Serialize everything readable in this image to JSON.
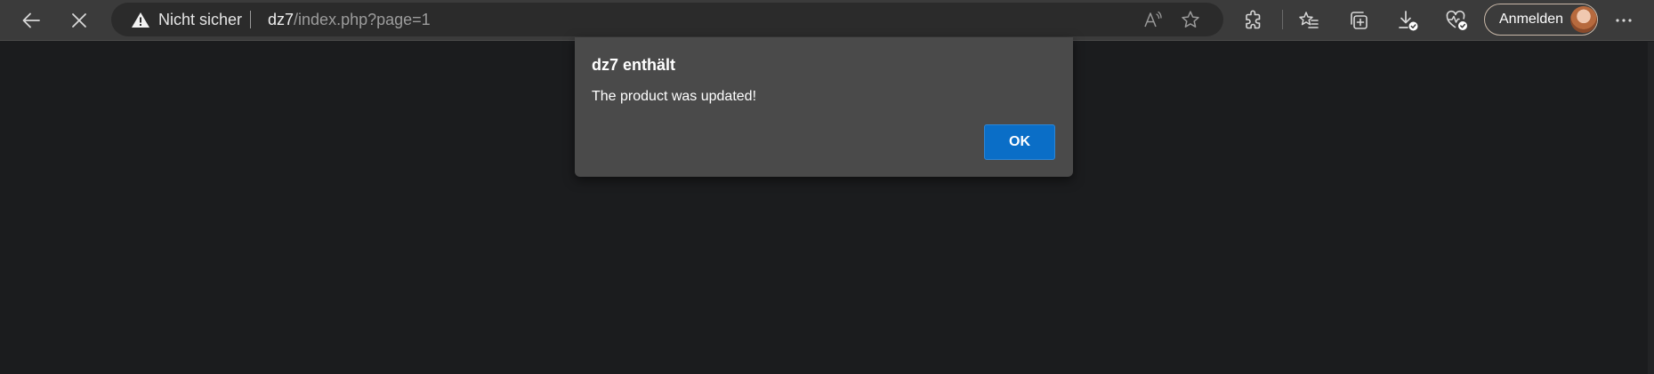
{
  "browser": {
    "address_bar": {
      "security_label": "Nicht sicher",
      "url_host": "dz7",
      "url_path": "/index.php?page=1"
    },
    "signin_label": "Anmelden",
    "icons": {
      "back": "arrow-left-icon",
      "stop": "close-icon",
      "warning": "warning-triangle-icon",
      "read_aloud": "read-aloud-icon",
      "favorite": "star-icon",
      "extensions": "puzzle-icon",
      "favorites": "favorites-list-icon",
      "collections": "collections-icon",
      "downloads": "download-icon",
      "health": "heart-pulse-icon",
      "menu": "more-horizontal-icon"
    }
  },
  "dialog": {
    "title": "dz7 enthält",
    "message": "The product was updated!",
    "ok_label": "OK"
  },
  "colors": {
    "page_background": "#1b1c1e",
    "dialog_background": "#4a4a4a",
    "ok_button": "#0a6ec7"
  }
}
